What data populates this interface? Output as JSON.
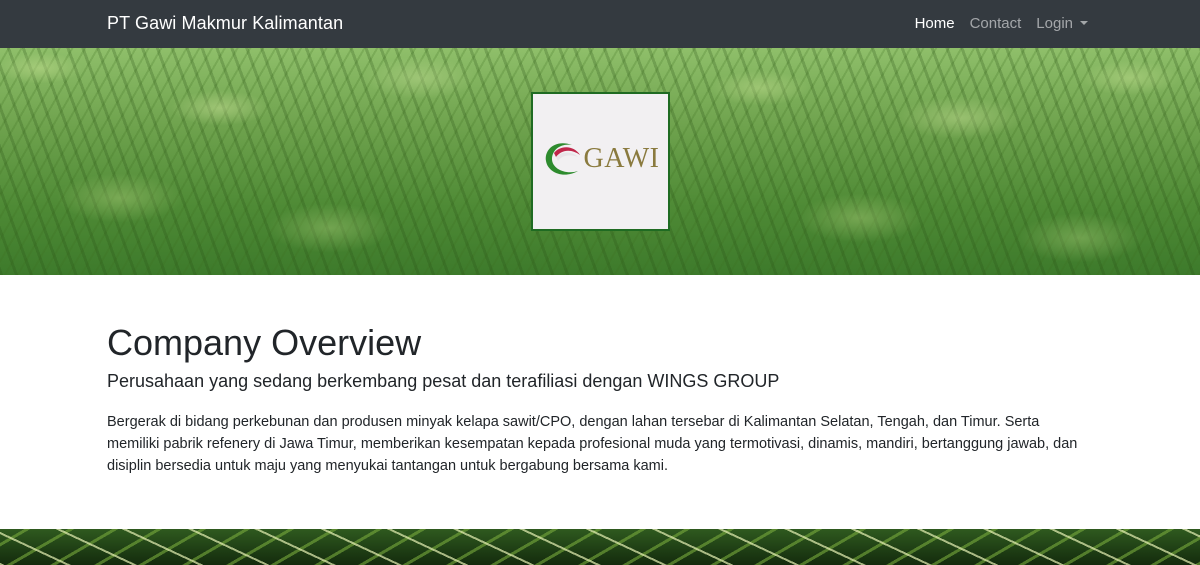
{
  "navbar": {
    "brand": "PT Gawi Makmur Kalimantan",
    "links": [
      {
        "label": "Home",
        "active": true
      },
      {
        "label": "Contact",
        "active": false
      },
      {
        "label": "Login",
        "active": false,
        "dropdown": true
      }
    ]
  },
  "hero": {
    "logo_text": "GAWI"
  },
  "overview": {
    "title": "Company Overview",
    "lead": "Perusahaan yang sedang berkembang pesat dan terafiliasi dengan WINGS GROUP",
    "body": "Bergerak di bidang perkebunan dan produsen minyak kelapa sawit/CPO, dengan lahan tersebar di Kalimantan Selatan, Tengah, dan Timur. Serta memiliki pabrik refenery di Jawa Timur, memberikan kesempatan kepada profesional muda yang termotivasi, dinamis, mandiri, bertanggung jawab, dan disiplin bersedia untuk maju yang menyukai tantangan untuk bergabung bersama kami."
  },
  "colors": {
    "navbar_bg": "#343a40",
    "logo_border": "#1f6b22",
    "logo_text": "#8a7a3e"
  }
}
